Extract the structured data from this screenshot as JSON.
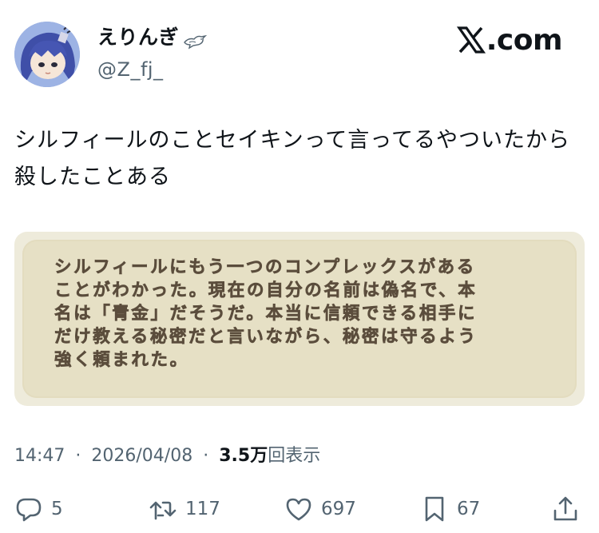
{
  "author": {
    "display_name": "えりんぎ",
    "handle": "@Z_fj_",
    "badge_icon": "bird-icon"
  },
  "brand": {
    "label": ".com",
    "icon": "x-logo-icon"
  },
  "tweet": {
    "text": "シルフィールのことセイキンって言ってるやついたから殺したことある"
  },
  "media": {
    "dialog_lines": [
      "シルフィールにもう一つのコンプレックスがある",
      "ことがわかった。現在の自分の名前は偽名で、本",
      "名は「青金」だそうだ。本当に信頼できる相手に",
      "だけ教える秘密だと言いながら、秘密は守るよう",
      "強く頼まれた。"
    ]
  },
  "meta": {
    "time": "14:47",
    "separator": "·",
    "date": "2026/04/08",
    "views_count": "3.5万",
    "views_label": "回表示"
  },
  "actions": {
    "replies": "5",
    "reposts": "117",
    "likes": "697",
    "bookmarks": "67"
  },
  "colors": {
    "text_primary": "#0f1419",
    "text_secondary": "#536471",
    "dialog_bg": "#e6e0c5",
    "dialog_text": "#5b4d3c"
  }
}
